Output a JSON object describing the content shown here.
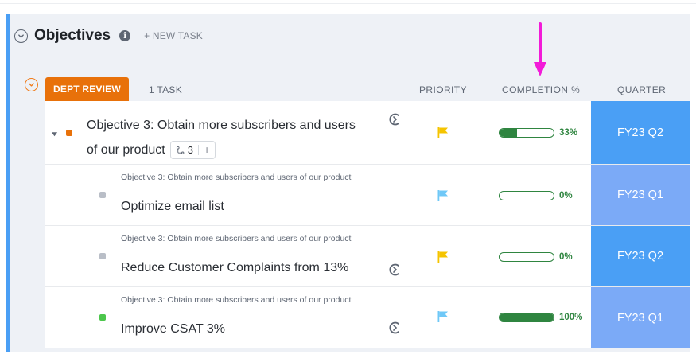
{
  "list": {
    "title": "Objectives",
    "new_task_label": "+ NEW TASK",
    "group": {
      "status": "DEPT REVIEW",
      "status_color": "#e8710a",
      "task_count": "1 TASK"
    },
    "columns": {
      "priority": "PRIORITY",
      "completion": "COMPLETION %",
      "quarter": "QUARTER"
    }
  },
  "annotation": {
    "arrow_color": "#f21bd8"
  },
  "rows": [
    {
      "name_line1": "Objective 3: Obtain more subscribers and users",
      "name_line2": "of our product",
      "subtask_count": "3",
      "subtask_add": "+",
      "status_color": "#e8710a",
      "priority_color": "#f5c400",
      "priority_icon": "flag-icon",
      "completion": 33,
      "completion_label": "33%",
      "quarter": "FY23 Q2",
      "quarter_color": "#4a9ff5"
    },
    {
      "parent": "Objective 3: Obtain more subscribers and users of our product",
      "name": "Optimize email list",
      "status_color": "#b9bec7",
      "priority_color": "#6fc8f7",
      "priority_icon": "flag-icon",
      "completion": 0,
      "completion_label": "0%",
      "quarter": "FY23 Q1",
      "quarter_color": "#7baaf7"
    },
    {
      "parent": "Objective 3: Obtain more subscribers and users of our product",
      "name": "Reduce Customer Complaints from 13%",
      "status_color": "#b9bec7",
      "priority_color": "#f5c400",
      "priority_icon": "flag-icon",
      "completion": 0,
      "completion_label": "0%",
      "quarter": "FY23 Q2",
      "quarter_color": "#4a9ff5"
    },
    {
      "parent": "Objective 3: Obtain more subscribers and users of our product",
      "name": "Improve CSAT 3%",
      "status_color": "#4cc64c",
      "priority_color": "#6fc8f7",
      "priority_icon": "flag-icon",
      "completion": 100,
      "completion_label": "100%",
      "quarter": "FY23 Q1",
      "quarter_color": "#7baaf7"
    }
  ]
}
